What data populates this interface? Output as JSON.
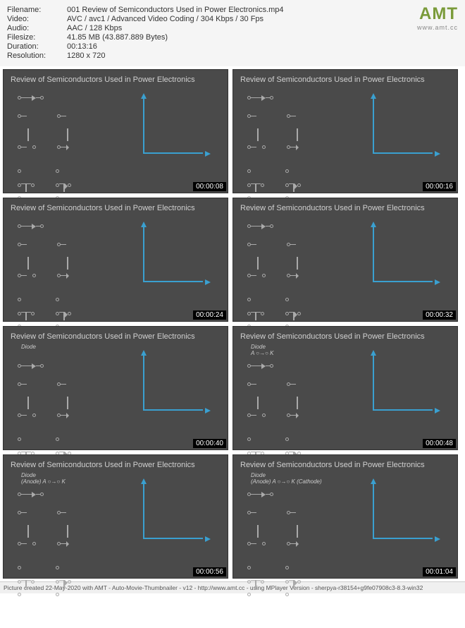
{
  "header": {
    "filename_label": "Filename:",
    "filename_value": "001 Review of Semiconductors Used in Power Electronics.mp4",
    "video_label": "Video:",
    "video_value": "AVC / avc1 / Advanced Video Coding / 304 Kbps / 30 Fps",
    "audio_label": "Audio:",
    "audio_value": "AAC / 128 Kbps",
    "filesize_label": "Filesize:",
    "filesize_value": "41.85 MB (43.887.889 Bytes)",
    "duration_label": "Duration:",
    "duration_value": "00:13:16",
    "resolution_label": "Resolution:",
    "resolution_value": "1280 x 720"
  },
  "logo": {
    "text": "AMT",
    "url": "www.amt.cc"
  },
  "frame_title": "Review of Semiconductors Used in Power Electronics",
  "thumbs": [
    {
      "timestamp": "00:00:08",
      "annotation": ""
    },
    {
      "timestamp": "00:00:16",
      "annotation": ""
    },
    {
      "timestamp": "00:00:24",
      "annotation": ""
    },
    {
      "timestamp": "00:00:32",
      "annotation": ""
    },
    {
      "timestamp": "00:00:40",
      "annotation": "Diode"
    },
    {
      "timestamp": "00:00:48",
      "annotation": "Diode\nA ○→○ K"
    },
    {
      "timestamp": "00:00:56",
      "annotation": "Diode\n(Anode) A ○→○ K"
    },
    {
      "timestamp": "00:01:04",
      "annotation": "Diode\n(Anode) A ○→○ K (Cathode)"
    }
  ],
  "footer": "Picture created 22-May-2020 with AMT - Auto-Movie-Thumbnailer - v12 - http://www.amt.cc - using MPlayer Version - sherpya-r38154+g9fe07908c3-8.3-win32"
}
